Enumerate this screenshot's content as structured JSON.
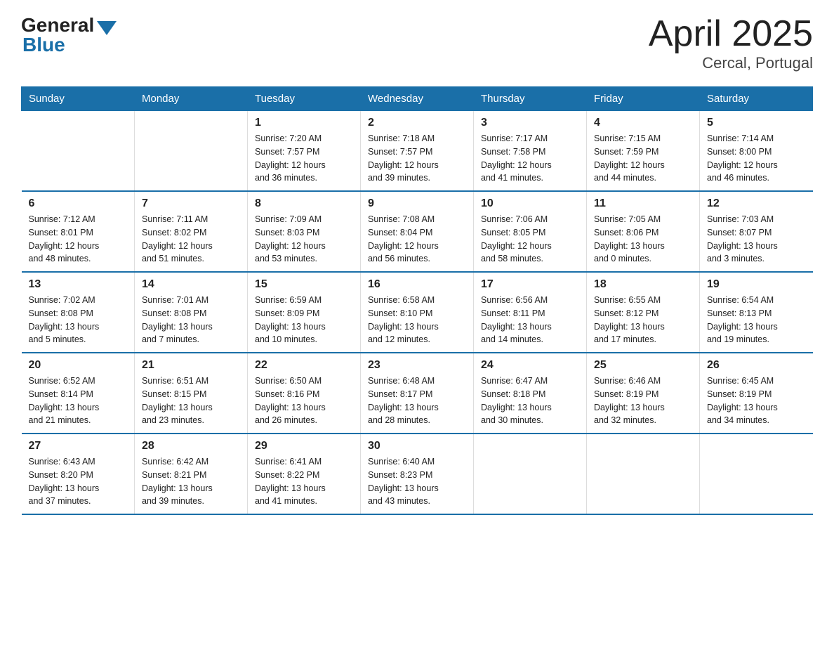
{
  "header": {
    "logo": {
      "general": "General",
      "blue": "Blue"
    },
    "title": "April 2025",
    "subtitle": "Cercal, Portugal"
  },
  "calendar": {
    "weekdays": [
      "Sunday",
      "Monday",
      "Tuesday",
      "Wednesday",
      "Thursday",
      "Friday",
      "Saturday"
    ],
    "weeks": [
      [
        {
          "day": "",
          "info": ""
        },
        {
          "day": "",
          "info": ""
        },
        {
          "day": "1",
          "info": "Sunrise: 7:20 AM\nSunset: 7:57 PM\nDaylight: 12 hours\nand 36 minutes."
        },
        {
          "day": "2",
          "info": "Sunrise: 7:18 AM\nSunset: 7:57 PM\nDaylight: 12 hours\nand 39 minutes."
        },
        {
          "day": "3",
          "info": "Sunrise: 7:17 AM\nSunset: 7:58 PM\nDaylight: 12 hours\nand 41 minutes."
        },
        {
          "day": "4",
          "info": "Sunrise: 7:15 AM\nSunset: 7:59 PM\nDaylight: 12 hours\nand 44 minutes."
        },
        {
          "day": "5",
          "info": "Sunrise: 7:14 AM\nSunset: 8:00 PM\nDaylight: 12 hours\nand 46 minutes."
        }
      ],
      [
        {
          "day": "6",
          "info": "Sunrise: 7:12 AM\nSunset: 8:01 PM\nDaylight: 12 hours\nand 48 minutes."
        },
        {
          "day": "7",
          "info": "Sunrise: 7:11 AM\nSunset: 8:02 PM\nDaylight: 12 hours\nand 51 minutes."
        },
        {
          "day": "8",
          "info": "Sunrise: 7:09 AM\nSunset: 8:03 PM\nDaylight: 12 hours\nand 53 minutes."
        },
        {
          "day": "9",
          "info": "Sunrise: 7:08 AM\nSunset: 8:04 PM\nDaylight: 12 hours\nand 56 minutes."
        },
        {
          "day": "10",
          "info": "Sunrise: 7:06 AM\nSunset: 8:05 PM\nDaylight: 12 hours\nand 58 minutes."
        },
        {
          "day": "11",
          "info": "Sunrise: 7:05 AM\nSunset: 8:06 PM\nDaylight: 13 hours\nand 0 minutes."
        },
        {
          "day": "12",
          "info": "Sunrise: 7:03 AM\nSunset: 8:07 PM\nDaylight: 13 hours\nand 3 minutes."
        }
      ],
      [
        {
          "day": "13",
          "info": "Sunrise: 7:02 AM\nSunset: 8:08 PM\nDaylight: 13 hours\nand 5 minutes."
        },
        {
          "day": "14",
          "info": "Sunrise: 7:01 AM\nSunset: 8:08 PM\nDaylight: 13 hours\nand 7 minutes."
        },
        {
          "day": "15",
          "info": "Sunrise: 6:59 AM\nSunset: 8:09 PM\nDaylight: 13 hours\nand 10 minutes."
        },
        {
          "day": "16",
          "info": "Sunrise: 6:58 AM\nSunset: 8:10 PM\nDaylight: 13 hours\nand 12 minutes."
        },
        {
          "day": "17",
          "info": "Sunrise: 6:56 AM\nSunset: 8:11 PM\nDaylight: 13 hours\nand 14 minutes."
        },
        {
          "day": "18",
          "info": "Sunrise: 6:55 AM\nSunset: 8:12 PM\nDaylight: 13 hours\nand 17 minutes."
        },
        {
          "day": "19",
          "info": "Sunrise: 6:54 AM\nSunset: 8:13 PM\nDaylight: 13 hours\nand 19 minutes."
        }
      ],
      [
        {
          "day": "20",
          "info": "Sunrise: 6:52 AM\nSunset: 8:14 PM\nDaylight: 13 hours\nand 21 minutes."
        },
        {
          "day": "21",
          "info": "Sunrise: 6:51 AM\nSunset: 8:15 PM\nDaylight: 13 hours\nand 23 minutes."
        },
        {
          "day": "22",
          "info": "Sunrise: 6:50 AM\nSunset: 8:16 PM\nDaylight: 13 hours\nand 26 minutes."
        },
        {
          "day": "23",
          "info": "Sunrise: 6:48 AM\nSunset: 8:17 PM\nDaylight: 13 hours\nand 28 minutes."
        },
        {
          "day": "24",
          "info": "Sunrise: 6:47 AM\nSunset: 8:18 PM\nDaylight: 13 hours\nand 30 minutes."
        },
        {
          "day": "25",
          "info": "Sunrise: 6:46 AM\nSunset: 8:19 PM\nDaylight: 13 hours\nand 32 minutes."
        },
        {
          "day": "26",
          "info": "Sunrise: 6:45 AM\nSunset: 8:19 PM\nDaylight: 13 hours\nand 34 minutes."
        }
      ],
      [
        {
          "day": "27",
          "info": "Sunrise: 6:43 AM\nSunset: 8:20 PM\nDaylight: 13 hours\nand 37 minutes."
        },
        {
          "day": "28",
          "info": "Sunrise: 6:42 AM\nSunset: 8:21 PM\nDaylight: 13 hours\nand 39 minutes."
        },
        {
          "day": "29",
          "info": "Sunrise: 6:41 AM\nSunset: 8:22 PM\nDaylight: 13 hours\nand 41 minutes."
        },
        {
          "day": "30",
          "info": "Sunrise: 6:40 AM\nSunset: 8:23 PM\nDaylight: 13 hours\nand 43 minutes."
        },
        {
          "day": "",
          "info": ""
        },
        {
          "day": "",
          "info": ""
        },
        {
          "day": "",
          "info": ""
        }
      ]
    ]
  }
}
